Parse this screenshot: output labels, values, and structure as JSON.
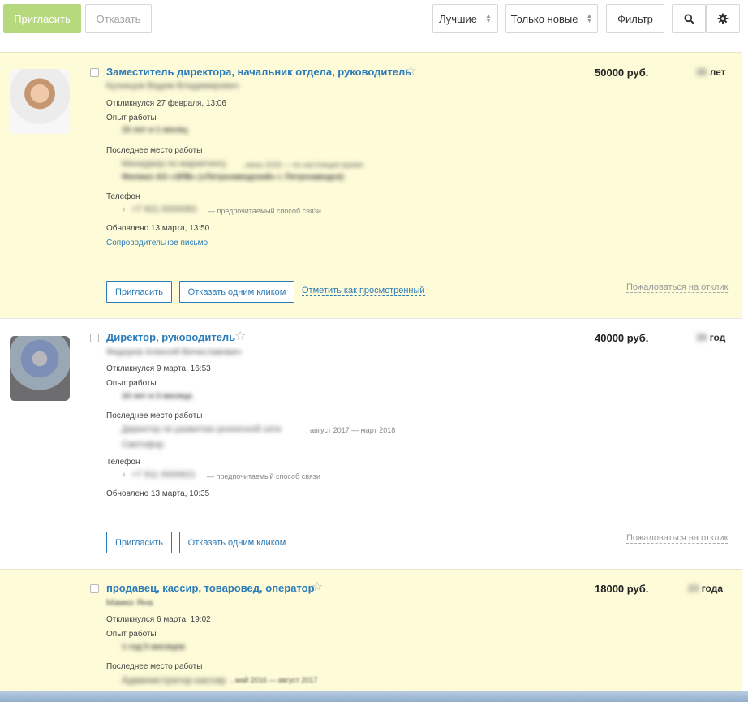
{
  "toolbar": {
    "invite_label": "Пригласить",
    "reject_label": "Отказать",
    "sort_best_label": "Лучшие",
    "only_new_label": "Только новые",
    "filter_label": "Фильтр",
    "search_icon": "search-icon",
    "settings_icon": "gear-icon"
  },
  "labels": {
    "experience": "Опыт работы",
    "last_job": "Последнее место работы",
    "phone": "Телефон",
    "preferred": "— предпочитаемый способ связи",
    "invite": "Пригласить",
    "reject_one_click": "Отказать одним кликом",
    "mark_viewed": "Отметить как просмотренный",
    "complain": "Пожаловаться на отклик",
    "cover_letter": "Сопроводительное письмо"
  },
  "cards": [
    {
      "title": "Заместитель директора, начальник отдела, руководитель",
      "salary": "50000 руб.",
      "age_num": "35",
      "age_word": "лет",
      "name": "Кузнецов Вадим Владимирович",
      "responded": "Откликнулся 27 февраля, 13:06",
      "experience_value": "15 лет и 1 месяц",
      "last_job_title": "Менеджер по маркетингу",
      "last_job_period": ", июнь 2016 — по настоящее время",
      "last_job_company": "Филиал АО «ЭЛВ» («Петрозаводский» г. Петрозаводск)",
      "phone_value": "+7 921 0000083",
      "updated": "Обновлено 13 марта, 13:50"
    },
    {
      "title": "Директор, руководитель",
      "salary": "40000 руб.",
      "age_num": "39",
      "age_word": "год",
      "name": "Федоров Алексей Вячеславович",
      "responded": "Откликнулся 9 марта, 16:53",
      "experience_value": "10 лет и 3 месяца",
      "last_job_title": "Директор по развитию розничной сети",
      "last_job_period": ", август 2017 — март 2018",
      "last_job_company": "Светофор",
      "phone_value": "+7 911 0000621",
      "updated": "Обновлено 13 марта, 10:35"
    },
    {
      "title": "продавец, кассир, товаровед, оператор",
      "salary": "18000 руб.",
      "age_num": "23",
      "age_word": "года",
      "name": "Мамко Яна",
      "responded": "Откликнулся 6 марта, 19:02",
      "experience_value": "1 год 5 месяцев",
      "last_job_title": "Администратор-кассир",
      "last_job_period": ", май 2016 — август 2017"
    }
  ]
}
